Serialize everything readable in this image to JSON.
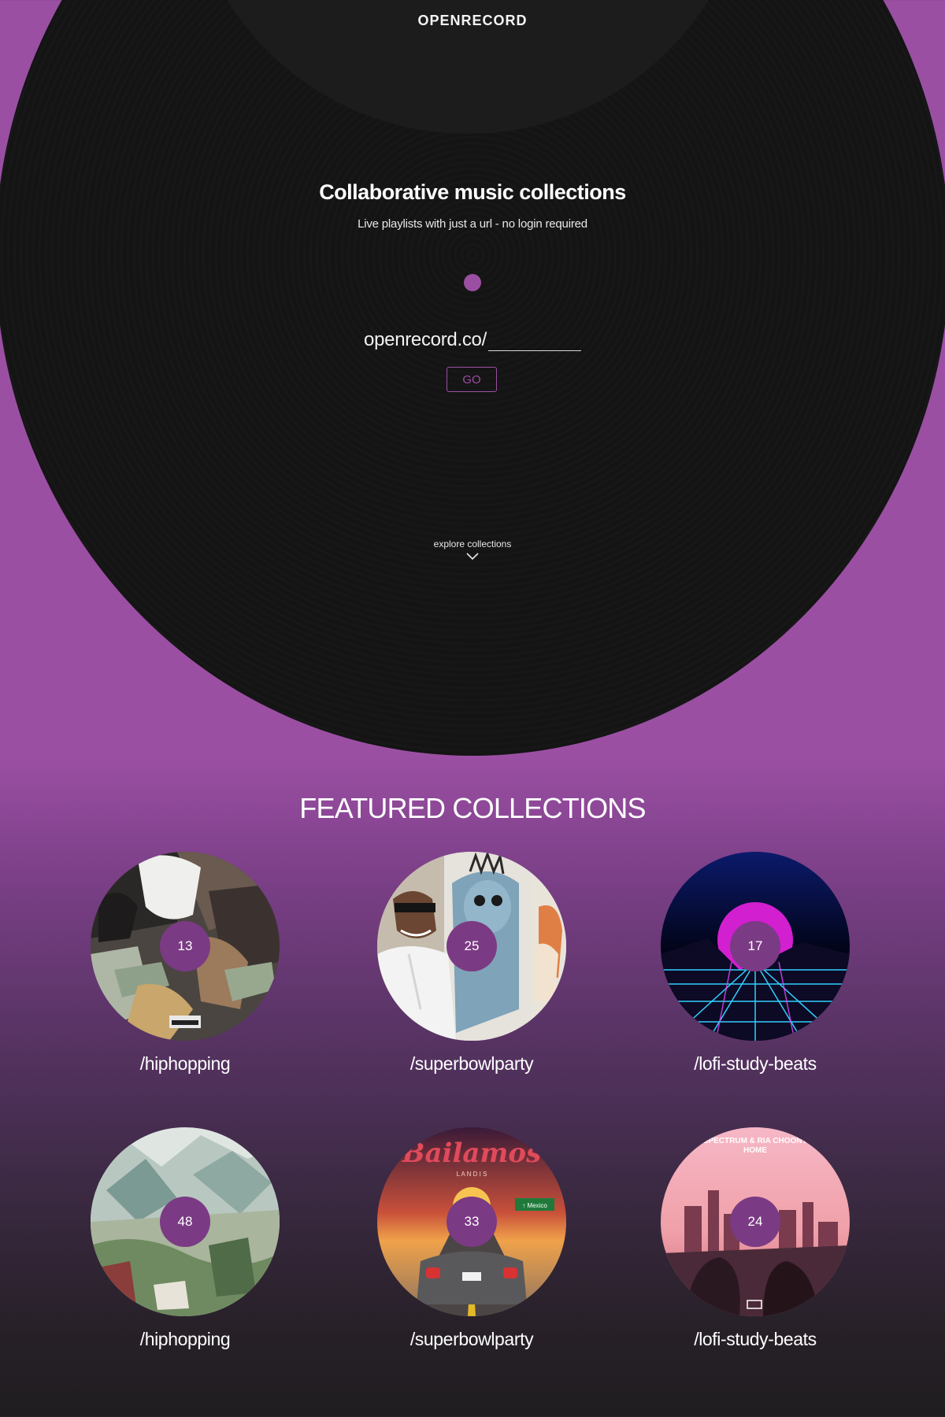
{
  "header": {
    "brand": "OPENRECORD"
  },
  "hero": {
    "title": "Collaborative music collections",
    "subtitle": "Live playlists with just a url - no login required",
    "url_prefix": "openrecord.co/",
    "url_input_value": "",
    "go_label": "GO",
    "explore_label": "explore collections"
  },
  "featured": {
    "title": "FEATURED COLLECTIONS",
    "collections": [
      {
        "name": "/hiphopping",
        "count": "13",
        "art": "money-cover"
      },
      {
        "name": "/superbowlparty",
        "count": "25",
        "art": "cartoon-cover"
      },
      {
        "name": "/lofi-study-beats",
        "count": "17",
        "art": "synthwave-cover"
      },
      {
        "name": "/hiphopping",
        "count": "48",
        "art": "landscape-painting-cover"
      },
      {
        "name": "/superbowlparty",
        "count": "33",
        "art": "bailamos-cover"
      },
      {
        "name": "/lofi-study-beats",
        "count": "24",
        "art": "city-sunset-cover"
      }
    ],
    "cover_text": {
      "bailamos_title": "Bailamos",
      "bailamos_artist": "L A N D I S",
      "bailamos_sign": "↑ Mexico",
      "home_artist": "SPECTRUM & RIA CHOONY",
      "home_title": "HOME"
    }
  },
  "colors": {
    "brand_purple": "#9b4fa3",
    "record_black": "#151515",
    "label_dark": "#1c1c1d",
    "count_badge": "#7b3a84"
  },
  "icons": {
    "explore": "chevron-down-icon"
  }
}
